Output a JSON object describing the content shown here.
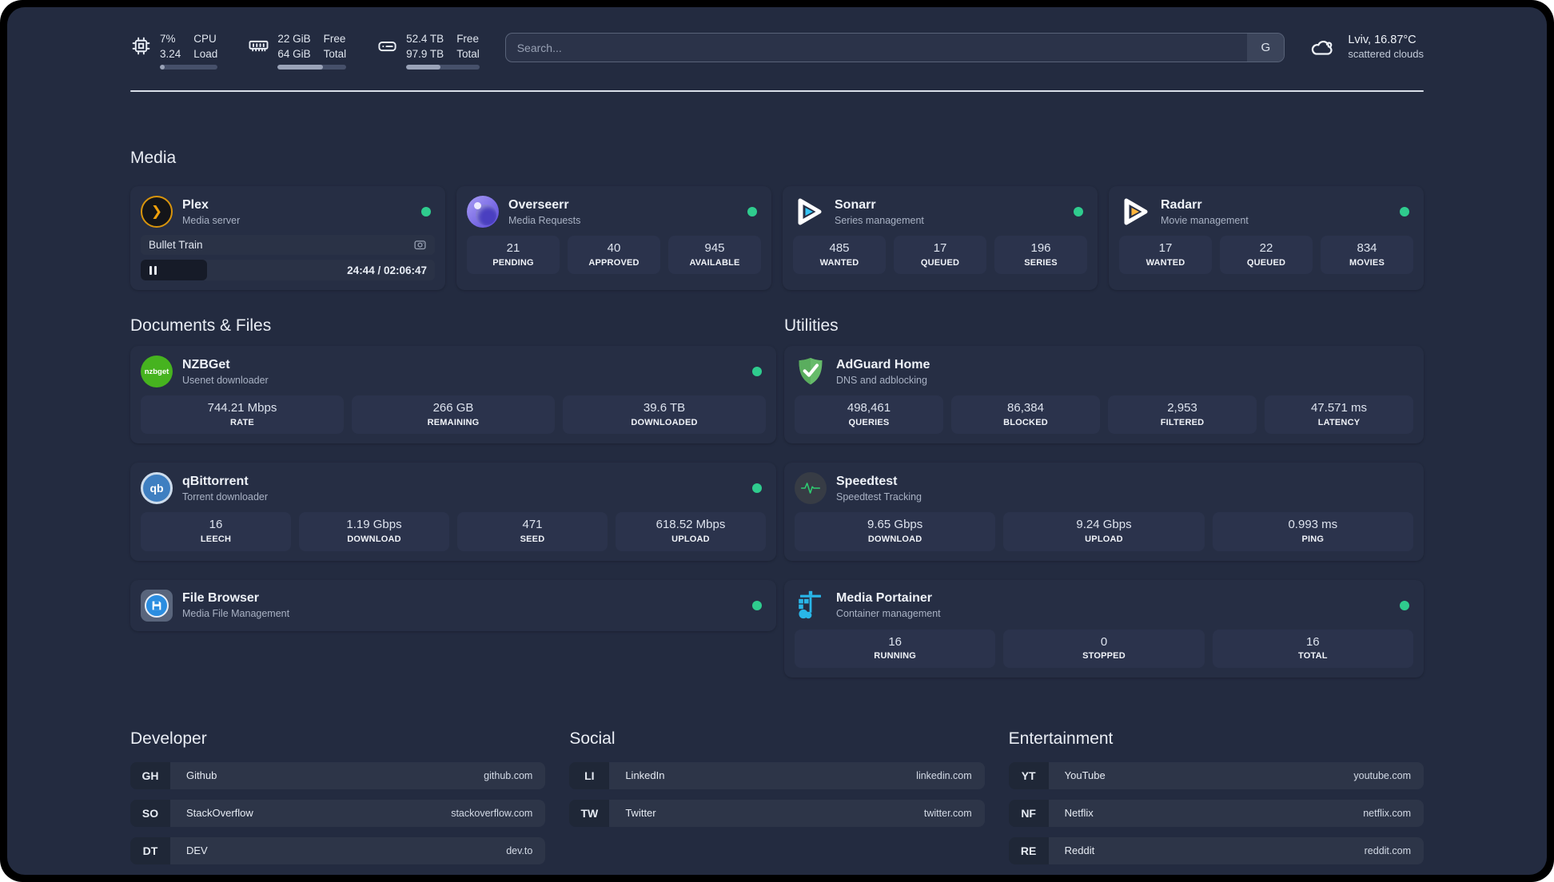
{
  "colors": {
    "online": "#2fcc8e",
    "accent_cyan": "#35c5f4",
    "accent_orange": "#ffb53c"
  },
  "topbar": {
    "stats": [
      {
        "icon": "cpu",
        "values": [
          "7%",
          "3.24"
        ],
        "labels": [
          "CPU",
          "Load"
        ],
        "progress_pct": 8
      },
      {
        "icon": "ram",
        "values": [
          "22 GiB",
          "64 GiB"
        ],
        "labels": [
          "Free",
          "Total"
        ],
        "progress_pct": 66
      },
      {
        "icon": "disk",
        "values": [
          "52.4 TB",
          "97.9 TB"
        ],
        "labels": [
          "Free",
          "Total"
        ],
        "progress_pct": 47
      }
    ],
    "search": {
      "placeholder": "Search...",
      "button_label": "G"
    },
    "weather": {
      "location_temp": "Lviv, 16.87°C",
      "condition": "scattered clouds"
    }
  },
  "sections": {
    "media": {
      "title": "Media",
      "cards": [
        {
          "id": "plex",
          "icon": "plex",
          "name": "Plex",
          "subtitle": "Media server",
          "online": true,
          "player": {
            "title": "Bullet Train",
            "time": "24:44 / 02:06:47",
            "progress_pct": 19.5
          }
        },
        {
          "id": "overseerr",
          "icon": "overseerr",
          "name": "Overseerr",
          "subtitle": "Media Requests",
          "online": true,
          "stats": [
            {
              "value": "21",
              "label": "PENDING"
            },
            {
              "value": "40",
              "label": "APPROVED"
            },
            {
              "value": "945",
              "label": "AVAILABLE"
            }
          ]
        },
        {
          "id": "sonarr",
          "icon": "sonarr",
          "name": "Sonarr",
          "subtitle": "Series management",
          "online": true,
          "stats": [
            {
              "value": "485",
              "label": "WANTED"
            },
            {
              "value": "17",
              "label": "QUEUED"
            },
            {
              "value": "196",
              "label": "SERIES"
            }
          ]
        },
        {
          "id": "radarr",
          "icon": "radarr",
          "name": "Radarr",
          "subtitle": "Movie management",
          "online": true,
          "stats": [
            {
              "value": "17",
              "label": "WANTED"
            },
            {
              "value": "22",
              "label": "QUEUED"
            },
            {
              "value": "834",
              "label": "MOVIES"
            }
          ]
        }
      ]
    },
    "documents": {
      "title": "Documents & Files",
      "cards": [
        {
          "id": "nzbget",
          "icon": "nzbget",
          "icon_text": "nzbget",
          "name": "NZBGet",
          "subtitle": "Usenet downloader",
          "online": true,
          "stats": [
            {
              "value": "744.21 Mbps",
              "label": "RATE"
            },
            {
              "value": "266 GB",
              "label": "REMAINING"
            },
            {
              "value": "39.6 TB",
              "label": "DOWNLOADED"
            }
          ]
        },
        {
          "id": "qbittorrent",
          "icon": "qbittorrent",
          "icon_text": "qb",
          "name": "qBittorrent",
          "subtitle": "Torrent downloader",
          "online": true,
          "stats": [
            {
              "value": "16",
              "label": "LEECH"
            },
            {
              "value": "1.19 Gbps",
              "label": "DOWNLOAD"
            },
            {
              "value": "471",
              "label": "SEED"
            },
            {
              "value": "618.52 Mbps",
              "label": "UPLOAD"
            }
          ]
        },
        {
          "id": "filebrowser",
          "icon": "filebrowser",
          "name": "File Browser",
          "subtitle": "Media File Management",
          "online": true
        }
      ]
    },
    "utilities": {
      "title": "Utilities",
      "cards": [
        {
          "id": "adguard",
          "icon": "adguard",
          "name": "AdGuard Home",
          "subtitle": "DNS and adblocking",
          "online": false,
          "stats": [
            {
              "value": "498,461",
              "label": "QUERIES"
            },
            {
              "value": "86,384",
              "label": "BLOCKED"
            },
            {
              "value": "2,953",
              "label": "FILTERED"
            },
            {
              "value": "47.571 ms",
              "label": "LATENCY"
            }
          ]
        },
        {
          "id": "speedtest",
          "icon": "speedtest",
          "name": "Speedtest",
          "subtitle": "Speedtest Tracking",
          "online": false,
          "stats": [
            {
              "value": "9.65 Gbps",
              "label": "DOWNLOAD"
            },
            {
              "value": "9.24 Gbps",
              "label": "UPLOAD"
            },
            {
              "value": "0.993 ms",
              "label": "PING"
            }
          ]
        },
        {
          "id": "portainer",
          "icon": "portainer",
          "name": "Media Portainer",
          "subtitle": "Container management",
          "online": true,
          "stats": [
            {
              "value": "16",
              "label": "RUNNING"
            },
            {
              "value": "0",
              "label": "STOPPED"
            },
            {
              "value": "16",
              "label": "TOTAL"
            }
          ]
        }
      ]
    }
  },
  "link_sections": [
    {
      "title": "Developer",
      "links": [
        {
          "abbr": "GH",
          "name": "Github",
          "url": "github.com"
        },
        {
          "abbr": "SO",
          "name": "StackOverflow",
          "url": "stackoverflow.com"
        },
        {
          "abbr": "DT",
          "name": "DEV",
          "url": "dev.to"
        }
      ]
    },
    {
      "title": "Social",
      "links": [
        {
          "abbr": "LI",
          "name": "LinkedIn",
          "url": "linkedin.com"
        },
        {
          "abbr": "TW",
          "name": "Twitter",
          "url": "twitter.com"
        }
      ]
    },
    {
      "title": "Entertainment",
      "links": [
        {
          "abbr": "YT",
          "name": "YouTube",
          "url": "youtube.com"
        },
        {
          "abbr": "NF",
          "name": "Netflix",
          "url": "netflix.com"
        },
        {
          "abbr": "RE",
          "name": "Reddit",
          "url": "reddit.com"
        }
      ]
    }
  ]
}
